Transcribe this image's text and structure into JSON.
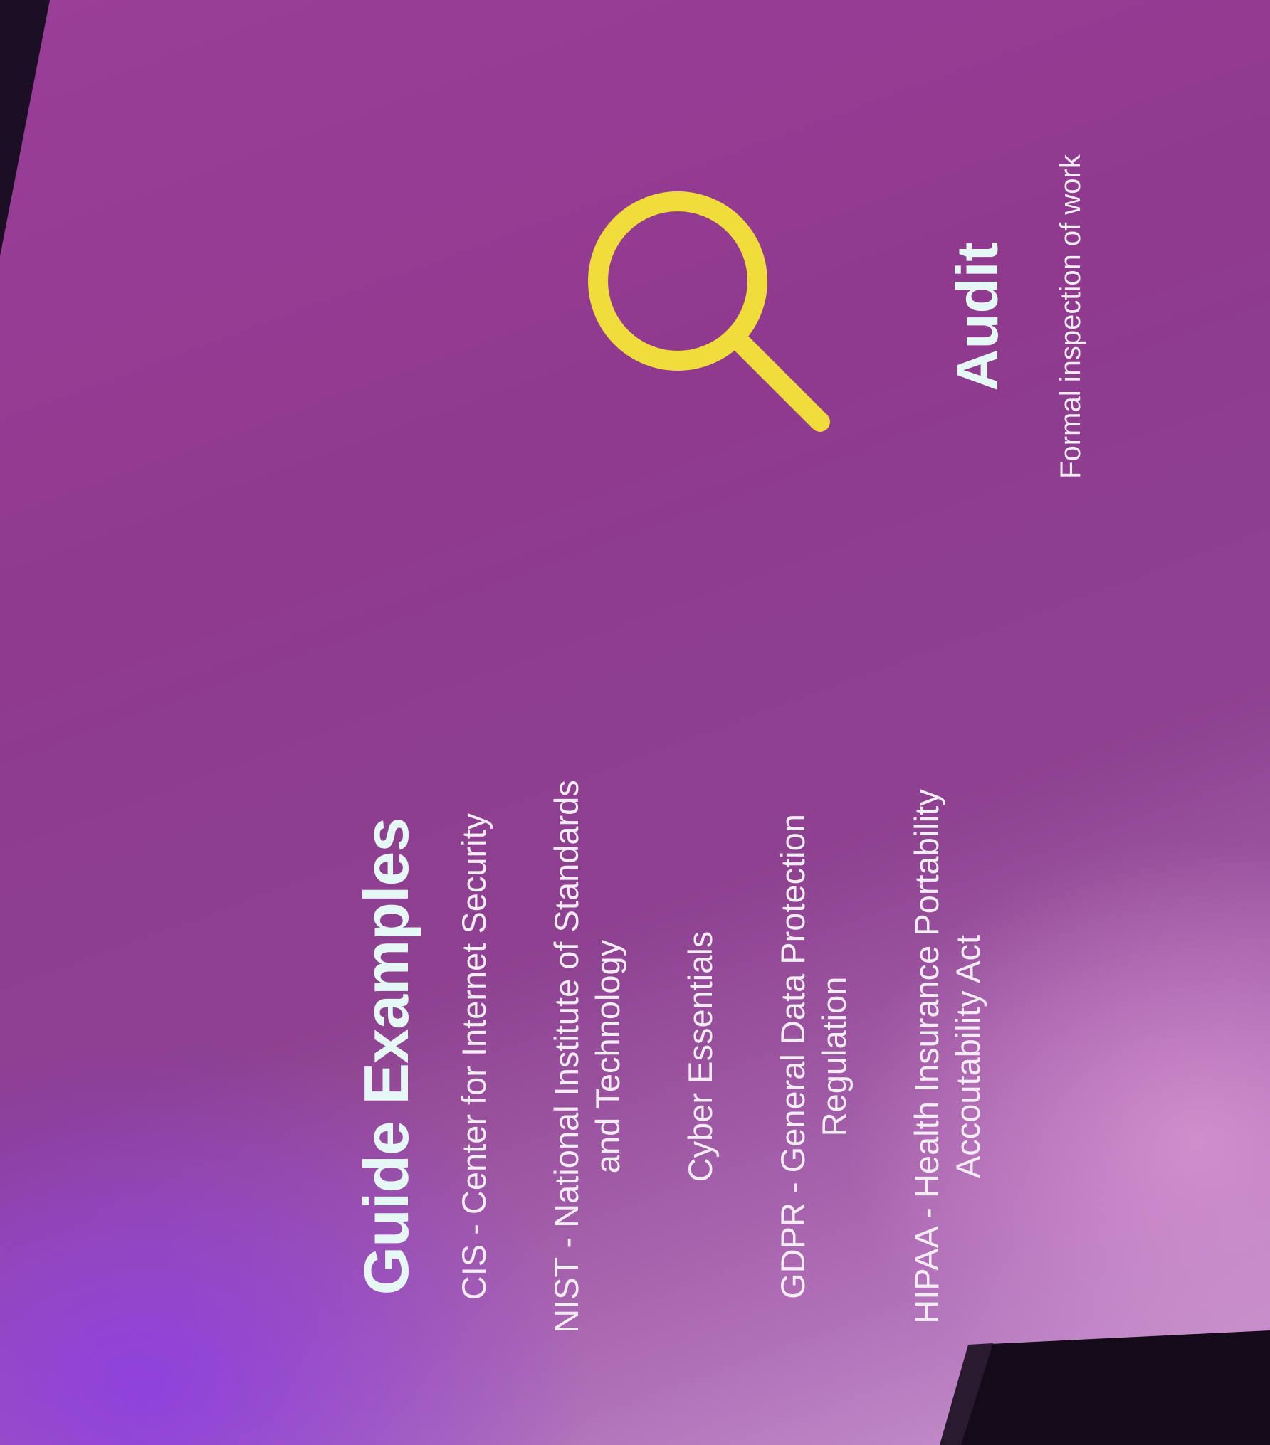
{
  "slide": {
    "heading": "Guide Examples",
    "guides": [
      {
        "lines": [
          "CIS - Center for Internet Security"
        ]
      },
      {
        "lines": [
          "NIST - National Institute of Standards",
          "and Technology"
        ]
      },
      {
        "lines": [
          "Cyber Essentials"
        ]
      },
      {
        "lines": [
          "GDPR - General Data Protection",
          "Regulation"
        ]
      },
      {
        "lines": [
          "HIPAA - Health Insurance Portability",
          "Accoutability Act"
        ]
      }
    ],
    "audit": {
      "icon": "magnifying-glass-icon",
      "title": "Audit",
      "subtitle": "Formal inspection of work"
    }
  },
  "colors": {
    "background": "#8f3a8e",
    "heading": "#e6f8f6",
    "text": "#f4ecf4",
    "icon": "#f0dc3a"
  }
}
